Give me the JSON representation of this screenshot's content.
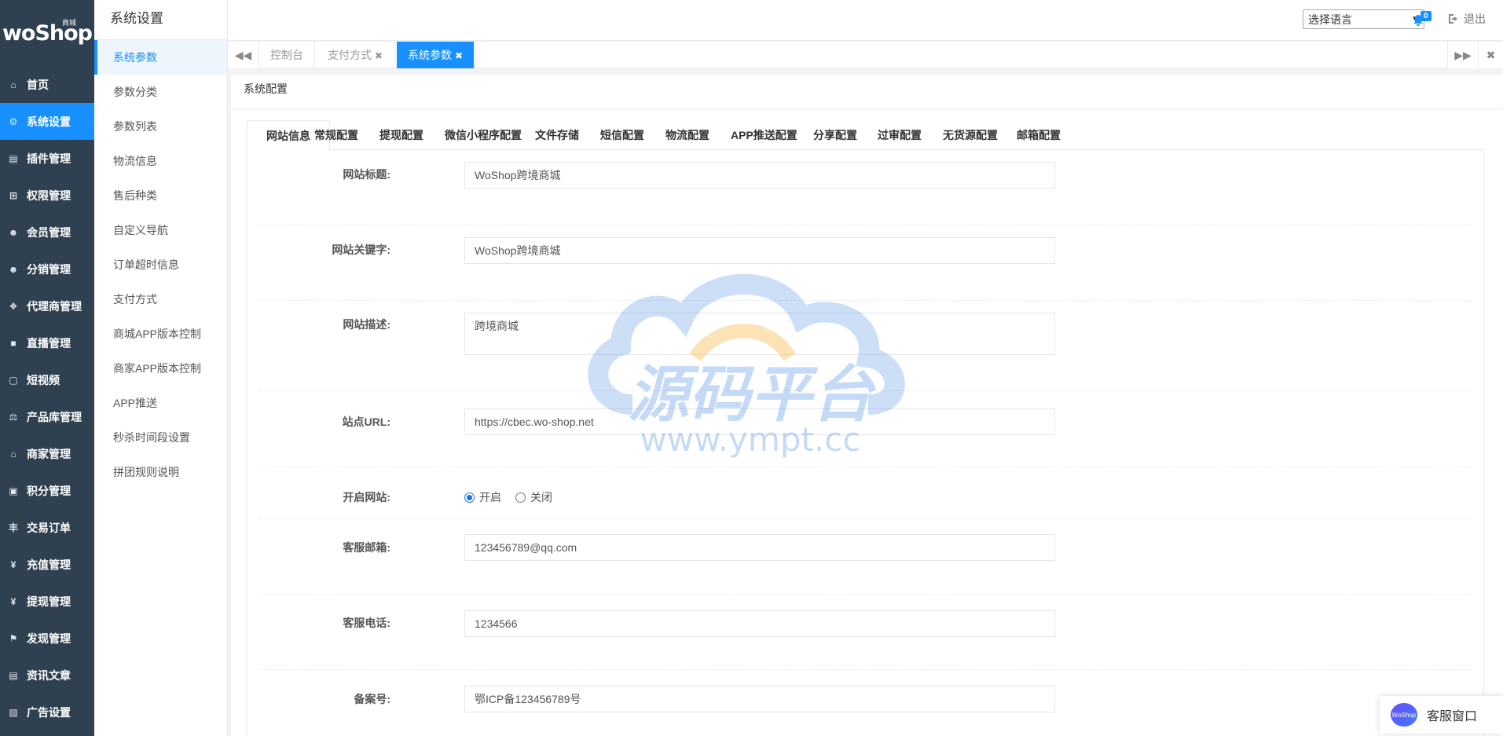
{
  "brand": {
    "logo": "woShop",
    "logo_sup": "商城"
  },
  "nav": {
    "items": [
      {
        "label": "首页",
        "icon": "home-icon",
        "glyph": "⌂"
      },
      {
        "label": "系统设置",
        "icon": "gear-icon",
        "glyph": "⚙",
        "active": true
      },
      {
        "label": "插件管理",
        "icon": "plugin-icon",
        "glyph": "▤"
      },
      {
        "label": "权限管理",
        "icon": "sitemap-icon",
        "glyph": "⊞"
      },
      {
        "label": "会员管理",
        "icon": "users-icon",
        "glyph": "☻"
      },
      {
        "label": "分销管理",
        "icon": "users-icon",
        "glyph": "☻"
      },
      {
        "label": "代理商管理",
        "icon": "cubes-icon",
        "glyph": "❖"
      },
      {
        "label": "直播管理",
        "icon": "video-icon",
        "glyph": "■"
      },
      {
        "label": "短视频",
        "icon": "file-icon",
        "glyph": "▢"
      },
      {
        "label": "产品库管理",
        "icon": "scale-icon",
        "glyph": "⚖"
      },
      {
        "label": "商家管理",
        "icon": "bank-icon",
        "glyph": "⌂"
      },
      {
        "label": "积分管理",
        "icon": "file-text-icon",
        "glyph": "▣"
      },
      {
        "label": "交易订单",
        "icon": "yen-icon",
        "glyph": "丰"
      },
      {
        "label": "充值管理",
        "icon": "yen-icon",
        "glyph": "¥"
      },
      {
        "label": "提现管理",
        "icon": "yen-icon",
        "glyph": "¥"
      },
      {
        "label": "发现管理",
        "icon": "flag-icon",
        "glyph": "⚑"
      },
      {
        "label": "资讯文章",
        "icon": "newspaper-icon",
        "glyph": "▤"
      },
      {
        "label": "广告设置",
        "icon": "image-icon",
        "glyph": "▨"
      }
    ]
  },
  "subnav": {
    "title": "系统设置",
    "items": [
      "系统参数",
      "参数分类",
      "参数列表",
      "物流信息",
      "售后种类",
      "自定义导航",
      "订单超时信息",
      "支付方式",
      "商城APP版本控制",
      "商家APP版本控制",
      "APP推送",
      "秒杀时间段设置",
      "拼团规则说明"
    ],
    "active_index": 0
  },
  "header": {
    "language_select": "选择语言",
    "notifications_count": "0",
    "logout": "退出"
  },
  "tabstrip": {
    "tabs": [
      {
        "label": "控制台",
        "closable": false
      },
      {
        "label": "支付方式",
        "closable": true
      },
      {
        "label": "系统参数",
        "closable": true,
        "active": true
      }
    ],
    "close_glyph": "✖"
  },
  "page": {
    "title": "系统配置",
    "tabs": [
      "网站信息",
      "常规配置",
      "提现配置",
      "微信小程序配置",
      "文件存储",
      "短信配置",
      "物流配置",
      "APP推送配置",
      "分享配置",
      "过审配置",
      "无货源配置",
      "邮箱配置"
    ],
    "active_tab": 0
  },
  "form": {
    "site_title": {
      "label": "网站标题:",
      "value": "WoShop跨境商城"
    },
    "site_keywords": {
      "label": "网站关键字:",
      "value": "WoShop跨境商城"
    },
    "site_description": {
      "label": "网站描述:",
      "value": "跨境商城"
    },
    "site_url": {
      "label": "站点URL:",
      "value": "https://cbec.wo-shop.net"
    },
    "site_open": {
      "label": "开启网站:",
      "options": [
        "开启",
        "关闭"
      ],
      "selected": "开启"
    },
    "service_email": {
      "label": "客服邮箱:",
      "value": "123456789@qq.com"
    },
    "service_phone": {
      "label": "客服电话:",
      "value": "1234566"
    },
    "icp": {
      "label": "备案号:",
      "value": "鄂ICP备123456789号"
    }
  },
  "watermark": {
    "title": "源码平台",
    "url": "www.ympt.cc"
  },
  "chat": {
    "label": "客服窗口",
    "avatar_text": "WoShop"
  },
  "colors": {
    "accent": "#1890ff",
    "sidebar": "#2f4050"
  }
}
